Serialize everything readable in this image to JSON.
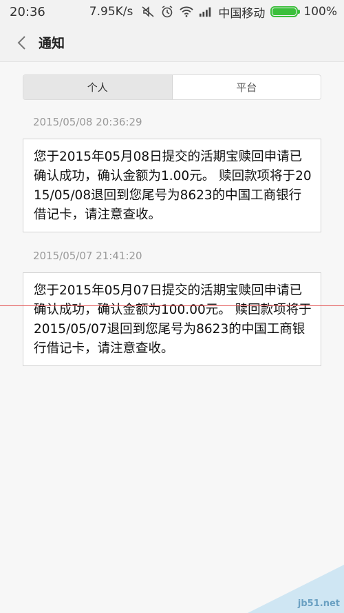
{
  "status_bar": {
    "time": "20:36",
    "net_speed": "7.95K/s",
    "carrier": "中国移动",
    "battery": "100%",
    "battery_level": 1.0,
    "icons": [
      "mute-icon",
      "alarm-icon",
      "wifi-icon",
      "signal-icon",
      "battery-icon"
    ]
  },
  "header": {
    "title": "通知",
    "back_icon": "chevron-left-icon"
  },
  "tabs": [
    {
      "label": "个人",
      "active": true
    },
    {
      "label": "平台",
      "active": false
    }
  ],
  "notifications": [
    {
      "timestamp": "2015/05/08 20:36:29",
      "text": "您于2015年05月08日提交的活期宝赎回申请已确认成功，确认金额为1.00元。 赎回款项将于2015/05/08退回到您尾号为8623的中国工商银行借记卡，请注意查收。"
    },
    {
      "timestamp": "2015/05/07 21:41:20",
      "text": "您于2015年05月07日提交的活期宝赎回申请已确认成功，确认金额为100.00元。 赎回款项将于2015/05/07退回到您尾号为8623的中国工商银行借记卡，请注意查收。"
    }
  ],
  "watermark": {
    "text": "jb51.net"
  },
  "colors": {
    "battery": "#3bbf3b",
    "red_line": "#e04848"
  }
}
